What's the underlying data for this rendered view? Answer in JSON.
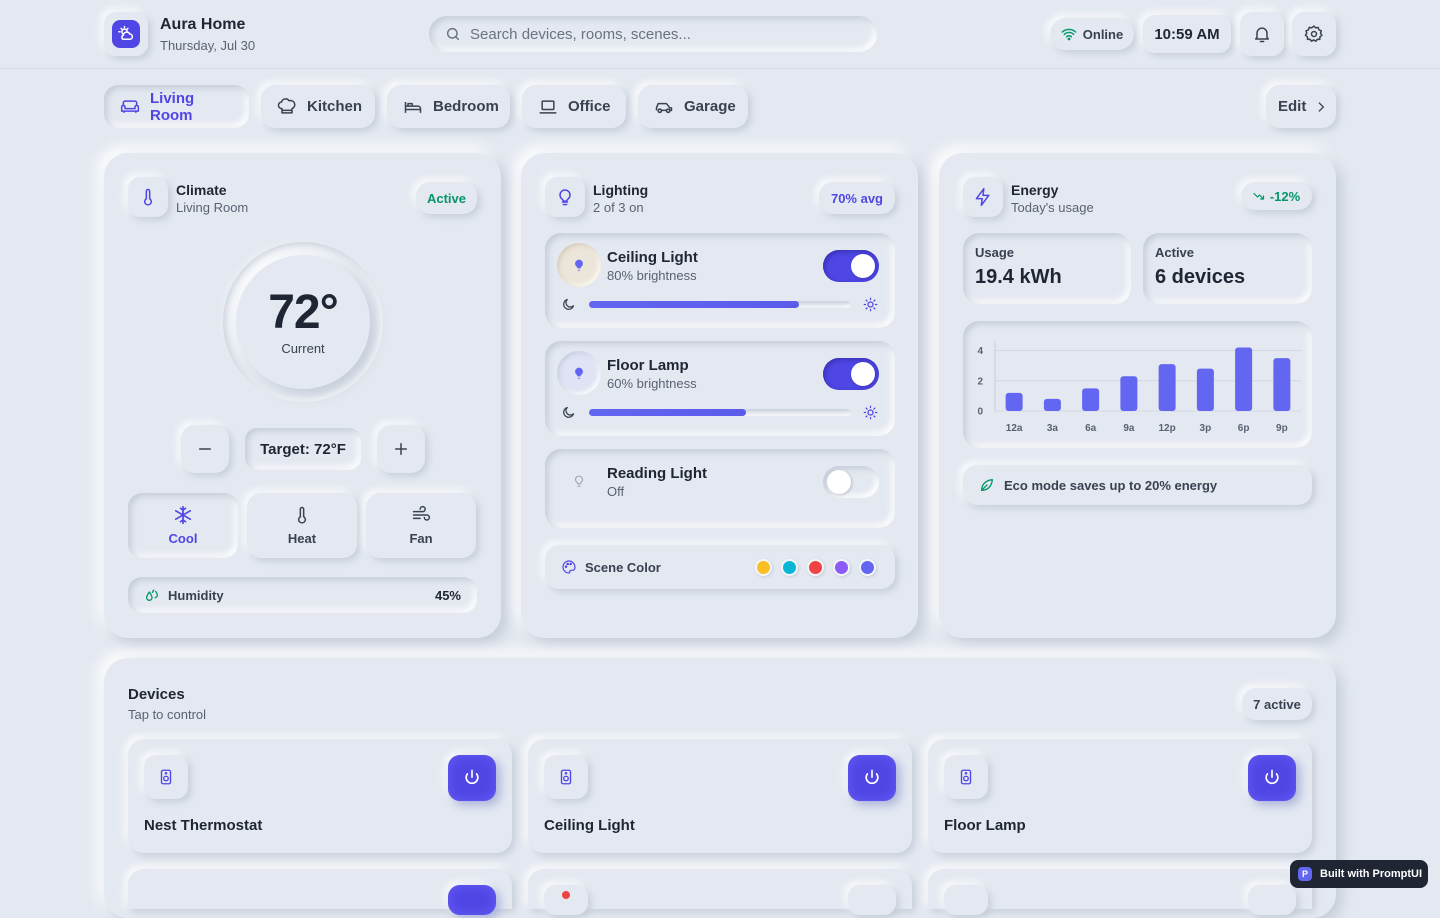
{
  "app": {
    "title": "Aura Home",
    "date": "Thursday, Jul 30"
  },
  "search": {
    "placeholder": "Search devices, rooms, scenes..."
  },
  "status": {
    "label": "Online",
    "time": "10:59 AM"
  },
  "rooms": [
    {
      "label": "Living Room",
      "icon": "sofa-icon",
      "active": true
    },
    {
      "label": "Kitchen",
      "icon": "chef-hat-icon"
    },
    {
      "label": "Bedroom",
      "icon": "bed-icon"
    },
    {
      "label": "Office",
      "icon": "laptop-icon"
    },
    {
      "label": "Garage",
      "icon": "car-icon"
    }
  ],
  "edit_label": "Edit",
  "climate": {
    "title": "Climate",
    "subtitle": "Living Room",
    "badge": "Active",
    "current": "72°",
    "current_label": "Current",
    "target": "Target: 72°F",
    "modes": [
      {
        "label": "Cool",
        "active": true
      },
      {
        "label": "Heat"
      },
      {
        "label": "Fan"
      }
    ],
    "humidity_label": "Humidity",
    "humidity_value": "45%"
  },
  "lighting": {
    "title": "Lighting",
    "subtitle": "2 of 3 on",
    "badge": "70% avg",
    "lights": [
      {
        "name": "Ceiling Light",
        "status": "80% brightness",
        "on": true,
        "level": 0.8
      },
      {
        "name": "Floor Lamp",
        "status": "60% brightness",
        "on": true,
        "level": 0.6
      },
      {
        "name": "Reading Light",
        "status": "Off",
        "on": false
      }
    ],
    "scene_label": "Scene Color",
    "scene_colors": [
      "#fbbf24",
      "#06b6d4",
      "#ef4444",
      "#8b5cf6",
      "#6366f1"
    ]
  },
  "energy": {
    "title": "Energy",
    "subtitle": "Today's usage",
    "badge": "-12%",
    "usage_label": "Usage",
    "usage_value": "19.4 kWh",
    "active_label": "Active",
    "active_value": "6 devices",
    "eco": "Eco mode saves up to 20% energy"
  },
  "chart_data": {
    "type": "bar",
    "categories": [
      "12a",
      "3a",
      "6a",
      "9a",
      "12p",
      "3p",
      "6p",
      "9p"
    ],
    "values": [
      1.2,
      0.8,
      1.5,
      2.3,
      3.1,
      2.8,
      4.2,
      3.5
    ],
    "yticks": [
      0,
      2,
      4
    ],
    "ylim": [
      0,
      4.3
    ],
    "color": "#6366f1"
  },
  "devices": {
    "title": "Devices",
    "subtitle": "Tap to control",
    "badge": "7 active",
    "items": [
      {
        "name": "Nest Thermostat"
      },
      {
        "name": "Ceiling Light"
      },
      {
        "name": "Floor Lamp"
      }
    ]
  },
  "footer_badge": {
    "logo": "P",
    "label": "Built with PromptUI"
  },
  "colors": {
    "accent": "#4f46e5",
    "success": "#059669",
    "background": "#e4e9f1"
  }
}
